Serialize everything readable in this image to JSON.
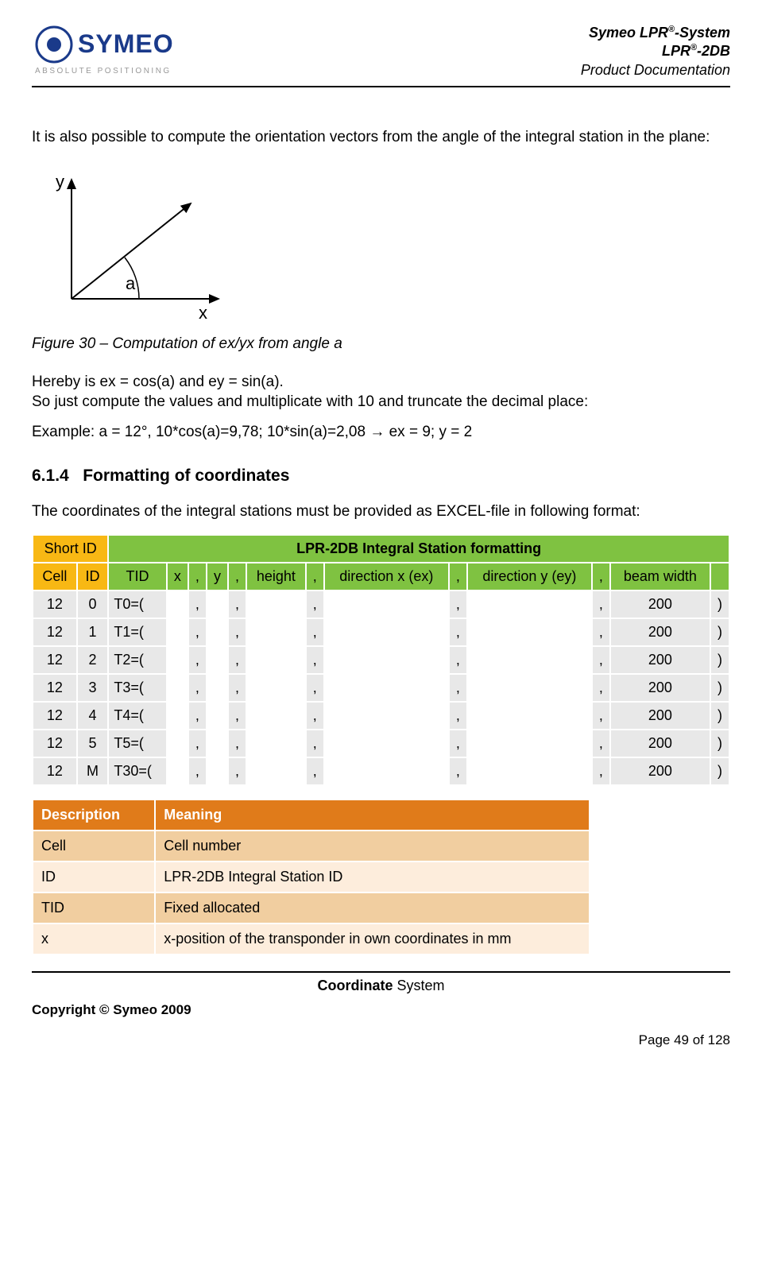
{
  "header": {
    "brand": "SYMEO",
    "tagline": "ABSOLUTE POSITIONING",
    "right1a": "Symeo LPR",
    "right1b": "-System",
    "right2a": "LPR",
    "right2b": "-2DB",
    "right3": "Product Documentation",
    "regmark": "®"
  },
  "content": {
    "p1": "It is also possible to compute the orientation vectors from the angle of the integral station in the plane:",
    "axis_y": "y",
    "axis_x": "x",
    "axis_a": "a",
    "fig_caption": "Figure 30 – Computation of ex/yx from angle a",
    "p2a": "Hereby is ex = cos(a) and ey = sin(a).",
    "p2b": "So just compute the values and multiplicate with 10 and truncate the decimal place:",
    "p3": "Example: a = 12°, 10*cos(a)=9,78; 10*sin(a)=2,08 → ex = 9; y = 2",
    "sec_num": "6.1.4",
    "sec_title": "Formatting of coordinates",
    "p4": "The coordinates of the integral stations must be provided as EXCEL-file in following format:"
  },
  "table1": {
    "short_id": "Short ID",
    "main_title": "LPR-2DB Integral Station formatting",
    "cols": {
      "cell": "Cell",
      "id": "ID",
      "tid": "TID",
      "x": "x",
      "y": "y",
      "height": "height",
      "dirx": "direction x (ex)",
      "diry": "direction y (ey)",
      "beam": "beam width",
      "comma": ",",
      "closep": ")"
    },
    "rows": [
      {
        "cell": "12",
        "id": "0",
        "tid": "T0=(",
        "beam": "200"
      },
      {
        "cell": "12",
        "id": "1",
        "tid": "T1=(",
        "beam": "200"
      },
      {
        "cell": "12",
        "id": "2",
        "tid": "T2=(",
        "beam": "200"
      },
      {
        "cell": "12",
        "id": "3",
        "tid": "T3=(",
        "beam": "200"
      },
      {
        "cell": "12",
        "id": "4",
        "tid": "T4=(",
        "beam": "200"
      },
      {
        "cell": "12",
        "id": "5",
        "tid": "T5=(",
        "beam": "200"
      },
      {
        "cell": "12",
        "id": "M",
        "tid": "T30=(",
        "beam": "200"
      }
    ]
  },
  "table2": {
    "h1": "Description",
    "h2": "Meaning",
    "rows": [
      {
        "a": "Cell",
        "b": "Cell number",
        "shade": "dark"
      },
      {
        "a": "ID",
        "b": "LPR-2DB Integral Station ID",
        "shade": "light"
      },
      {
        "a": "TID",
        "b": "Fixed allocated",
        "shade": "dark"
      },
      {
        "a": "x",
        "b": "x-position of the transponder in own coordinates in mm",
        "shade": "light"
      }
    ]
  },
  "footer": {
    "center_bold": "Coordinate",
    "center_rest": " System",
    "copyright": "Copyright © Symeo 2009",
    "pagenum": "Page 49 of 128"
  }
}
